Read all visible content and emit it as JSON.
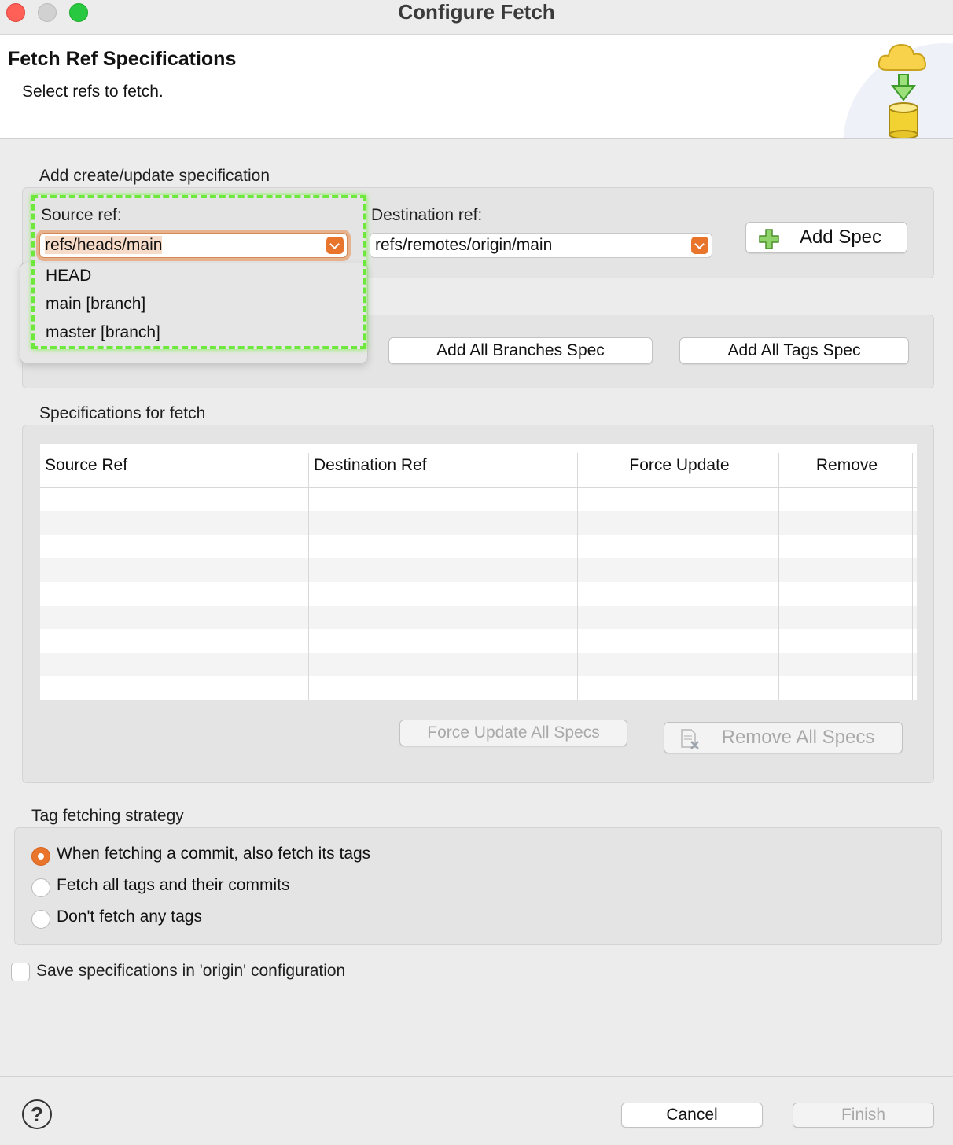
{
  "window": {
    "title": "Configure Fetch"
  },
  "header": {
    "title": "Fetch Ref Specifications",
    "subtitle": "Select refs to fetch."
  },
  "create_spec": {
    "group_label": "Add create/update specification",
    "source_label": "Source ref:",
    "source_value": "refs/heads/main",
    "destination_label": "Destination ref:",
    "destination_value": "refs/remotes/origin/main",
    "add_spec_label": "Add Spec",
    "dropdown_options": [
      "HEAD",
      "main [branch]",
      "master [branch]"
    ]
  },
  "predefined": {
    "add_all_branches_label": "Add All Branches Spec",
    "add_all_tags_label": "Add All Tags Spec"
  },
  "specs": {
    "group_label": "Specifications for fetch",
    "columns": [
      "Source Ref",
      "Destination Ref",
      "Force Update",
      "Remove"
    ],
    "rows": [],
    "force_update_all_label": "Force Update All Specs",
    "remove_all_label": "Remove All Specs"
  },
  "tags": {
    "group_label": "Tag fetching strategy",
    "options": [
      {
        "label": "When fetching a commit, also fetch its tags",
        "selected": true
      },
      {
        "label": "Fetch all tags and their commits",
        "selected": false
      },
      {
        "label": "Don't fetch any tags",
        "selected": false
      }
    ]
  },
  "save_config": {
    "label": "Save specifications in 'origin' configuration",
    "checked": false
  },
  "footer": {
    "help_icon": "question-mark-icon",
    "cancel_label": "Cancel",
    "finish_label": "Finish"
  },
  "colors": {
    "accent": "#e9742b",
    "highlight": "#6ee83c"
  }
}
